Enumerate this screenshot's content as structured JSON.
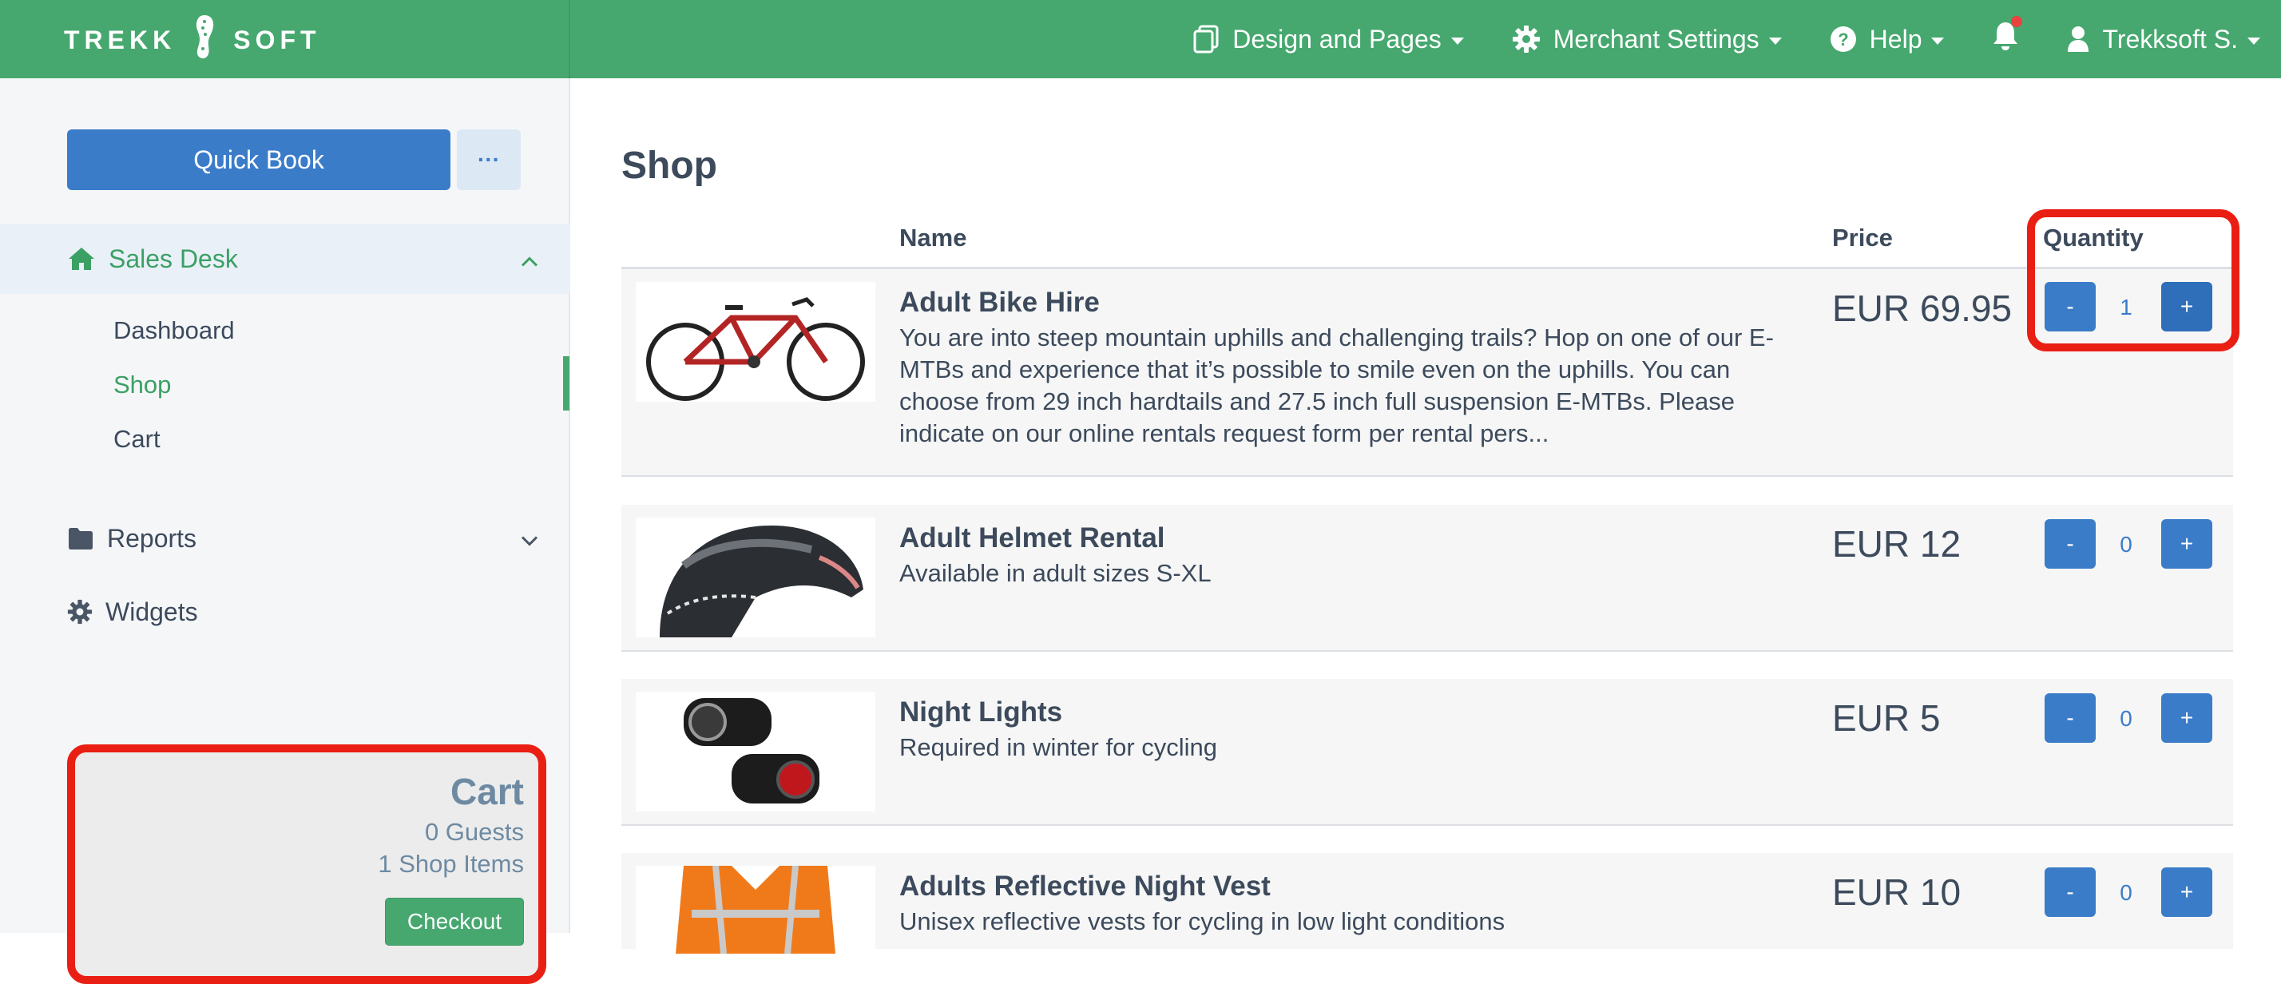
{
  "header": {
    "brand_left": "TREKK",
    "brand_right": "SOFT",
    "nav": [
      {
        "label": "Design and Pages",
        "icon": "copy-icon"
      },
      {
        "label": "Merchant Settings",
        "icon": "gear-icon"
      },
      {
        "label": "Help",
        "icon": "question-circle-icon"
      }
    ],
    "user": "Trekksoft S.",
    "colors": {
      "bar": "#46a86f",
      "notification_dot": "#e8423f"
    }
  },
  "sidebar": {
    "quick_book": "Quick Book",
    "more": "···",
    "sales_desk": "Sales Desk",
    "sub_items": [
      "Dashboard",
      "Shop",
      "Cart"
    ],
    "active_item": "Shop",
    "reports": "Reports",
    "widgets": "Widgets",
    "cart": {
      "title": "Cart",
      "guests": "0 Guests",
      "shop_items": "1 Shop Items",
      "checkout": "Checkout"
    }
  },
  "main": {
    "title": "Shop",
    "columns": {
      "name": "Name",
      "price": "Price",
      "quantity": "Quantity"
    },
    "products": [
      {
        "name": "Adult Bike Hire",
        "description": "You are into steep mountain uphills and challenging trails? Hop on one of our E-MTBs and experience that it’s possible to smile even on the uphills. You can choose from 29 inch hardtails and 27.5 inch full suspension E-MTBs. Please indicate on our online rentals request form per rental pers...",
        "price": "EUR 69.95",
        "quantity": "1",
        "image": "red-bicycle"
      },
      {
        "name": "Adult Helmet Rental",
        "description": "Available in adult sizes S-XL",
        "price": "EUR 12",
        "quantity": "0",
        "image": "bike-helmet"
      },
      {
        "name": "Night Lights",
        "description": "Required in winter for cycling",
        "price": "EUR 5",
        "quantity": "0",
        "image": "bike-lights"
      },
      {
        "name": "Adults Reflective Night Vest",
        "description": "Unisex reflective vests for cycling in low light conditions",
        "price": "EUR 10",
        "quantity": "0",
        "image": "reflective-vest"
      }
    ],
    "minus_label": "-",
    "plus_label": "+"
  }
}
